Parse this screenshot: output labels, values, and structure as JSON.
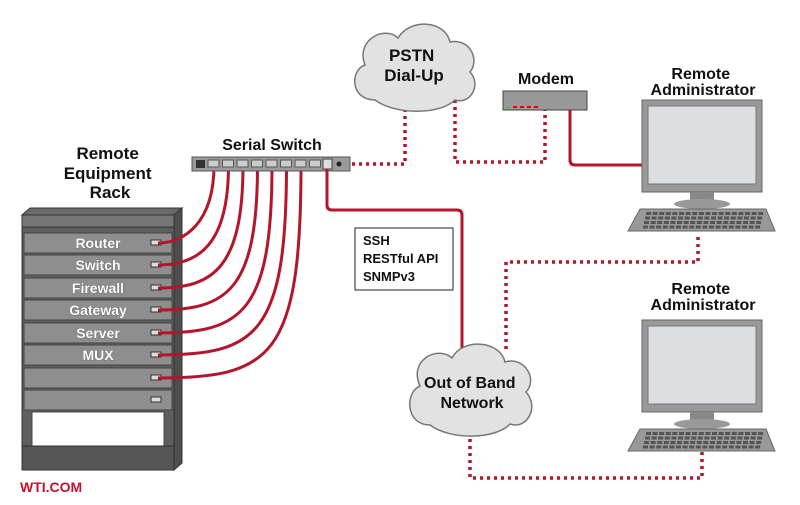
{
  "labels": {
    "rack_title": [
      "Remote",
      "Equipment",
      "Rack"
    ],
    "serial_switch": "Serial Switch",
    "pstn": [
      "PSTN",
      "Dial-Up"
    ],
    "modem": "Modem",
    "admin1": [
      "Remote",
      "Administrator"
    ],
    "admin2": [
      "Remote",
      "Administrator"
    ],
    "oob": [
      "Out of Band",
      "Network"
    ],
    "protocols": [
      "SSH",
      "RESTful API",
      "SNMPv3"
    ],
    "brand": "WTI.COM"
  },
  "rack_units": [
    "Router",
    "Switch",
    "Firewall",
    "Gateway",
    "Server",
    "MUX",
    "",
    ""
  ],
  "colors": {
    "cable": "#b5152b",
    "brand": "#c8102e",
    "device_gray": "#8c8c8c",
    "screen": "#dcdee2"
  }
}
